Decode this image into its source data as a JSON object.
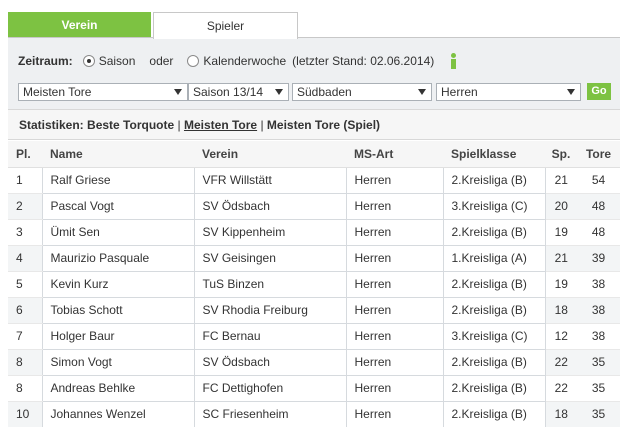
{
  "tabs": {
    "verein": "Verein",
    "spieler": "Spieler"
  },
  "filter": {
    "zeitraum_label": "Zeitraum:",
    "saison": "Saison",
    "oder": "oder",
    "kalenderwoche": "Kalenderwoche",
    "stand": "(letzter Stand: 02.06.2014)",
    "statistik": "Meisten Tore",
    "saison_select": "Saison 13/14",
    "verband": "Südbaden",
    "klasse": "Herren",
    "go": "Go"
  },
  "stats": {
    "label": "Statistiken:",
    "link1": "Beste Torquote",
    "sep1": "|",
    "link2": "Meisten Tore",
    "sep2": "|",
    "link3": "Meisten Tore (Spiel)"
  },
  "table": {
    "headers": {
      "pl": "Pl.",
      "name": "Name",
      "verein": "Verein",
      "msart": "MS-Art",
      "spielklasse": "Spielklasse",
      "sp": "Sp.",
      "tore": "Tore"
    },
    "rows": [
      {
        "pl": "1",
        "name": "Ralf Griese",
        "verein": "VFR Willstätt",
        "msart": "Herren",
        "klasse": "2.Kreisliga (B)",
        "sp": "21",
        "tore": "54"
      },
      {
        "pl": "2",
        "name": "Pascal Vogt",
        "verein": "SV Ödsbach",
        "msart": "Herren",
        "klasse": "3.Kreisliga (C)",
        "sp": "20",
        "tore": "48"
      },
      {
        "pl": "3",
        "name": "Ümit Sen",
        "verein": "SV Kippenheim",
        "msart": "Herren",
        "klasse": "2.Kreisliga (B)",
        "sp": "19",
        "tore": "48"
      },
      {
        "pl": "4",
        "name": "Maurizio Pasquale",
        "verein": "SV Geisingen",
        "msart": "Herren",
        "klasse": "1.Kreisliga (A)",
        "sp": "21",
        "tore": "39"
      },
      {
        "pl": "5",
        "name": "Kevin Kurz",
        "verein": "TuS Binzen",
        "msart": "Herren",
        "klasse": "2.Kreisliga (B)",
        "sp": "19",
        "tore": "38"
      },
      {
        "pl": "6",
        "name": "Tobias Schott",
        "verein": "SV Rhodia Freiburg",
        "msart": "Herren",
        "klasse": "2.Kreisliga (B)",
        "sp": "18",
        "tore": "38"
      },
      {
        "pl": "7",
        "name": "Holger Baur",
        "verein": "FC Bernau",
        "msart": "Herren",
        "klasse": "3.Kreisliga (C)",
        "sp": "12",
        "tore": "38"
      },
      {
        "pl": "8",
        "name": "Simon Vogt",
        "verein": "SV Ödsbach",
        "msart": "Herren",
        "klasse": "2.Kreisliga (B)",
        "sp": "22",
        "tore": "35"
      },
      {
        "pl": "8",
        "name": "Andreas Behlke",
        "verein": "FC Dettighofen",
        "msart": "Herren",
        "klasse": "2.Kreisliga (B)",
        "sp": "22",
        "tore": "35"
      },
      {
        "pl": "10",
        "name": "Johannes Wenzel",
        "verein": "SC Friesenheim",
        "msart": "Herren",
        "klasse": "2.Kreisliga (B)",
        "sp": "18",
        "tore": "35"
      }
    ]
  }
}
